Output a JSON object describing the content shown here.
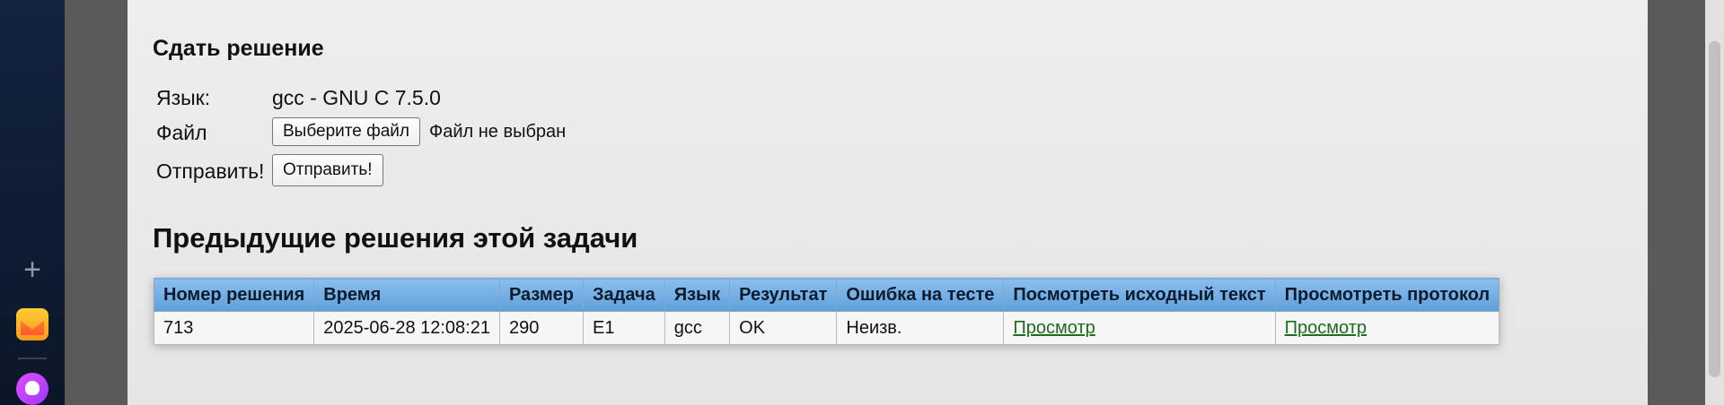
{
  "submit": {
    "title": "Сдать решение",
    "language_label": "Язык:",
    "language_value": "gcc - GNU C 7.5.0",
    "file_label": "Файл",
    "choose_file_button": "Выберите файл",
    "file_status": "Файл не выбран",
    "send_label": "Отправить!",
    "send_button": "Отправить!"
  },
  "previous": {
    "title": "Предыдущие решения этой задачи",
    "columns": [
      "Номер решения",
      "Время",
      "Размер",
      "Задача",
      "Язык",
      "Результат",
      "Ошибка на тесте",
      "Посмотреть исходный текст",
      "Просмотреть протокол"
    ],
    "rows": [
      {
        "id": "713",
        "time": "2025-06-28 12:08:21",
        "size": "290",
        "task": "E1",
        "language": "gcc",
        "result": "OK",
        "failed_test": "Неизв.",
        "view_source": "Просмотр",
        "view_protocol": "Просмотр"
      }
    ]
  },
  "sidebar": {
    "add_icon": "plus-icon",
    "apps": [
      "mail-app-icon",
      "alice-app-icon"
    ]
  },
  "colors": {
    "header_blue": "#6fa8e0",
    "link_green": "#1f6b1f",
    "sidebar_dark": "#0f1d33"
  }
}
